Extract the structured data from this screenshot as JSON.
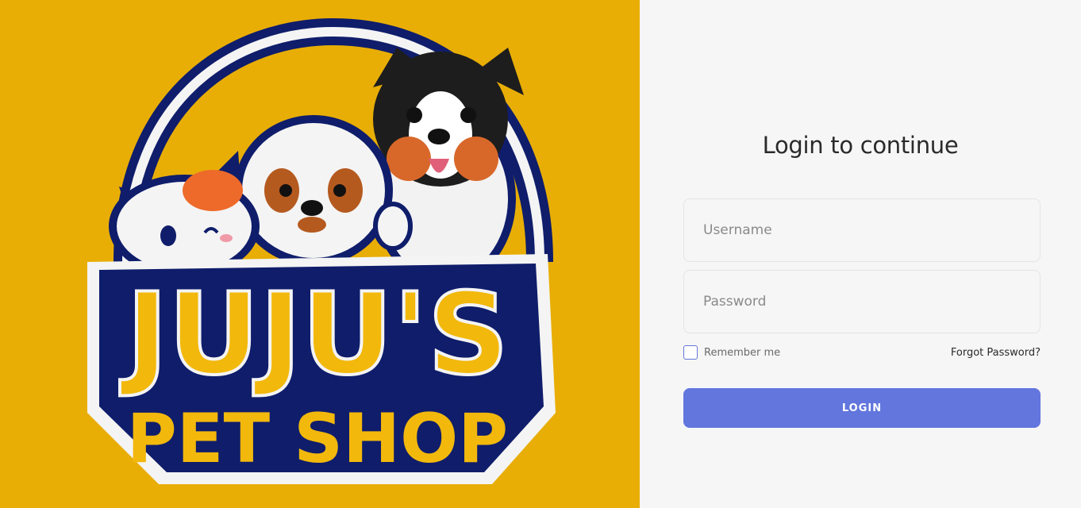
{
  "logo": {
    "line1": "JUJU'S",
    "line2": "PET SHOP"
  },
  "login": {
    "title": "Login to continue",
    "username_placeholder": "Username",
    "password_placeholder": "Password",
    "remember_label": "Remember me",
    "remember_checked": false,
    "forgot_label": "Forgot Password?",
    "login_button": "LOGIN"
  },
  "colors": {
    "brand_background": "#e8ae06",
    "logo_navy": "#0f1d6b",
    "logo_yellow": "#f2b80c",
    "button": "#6276de"
  }
}
